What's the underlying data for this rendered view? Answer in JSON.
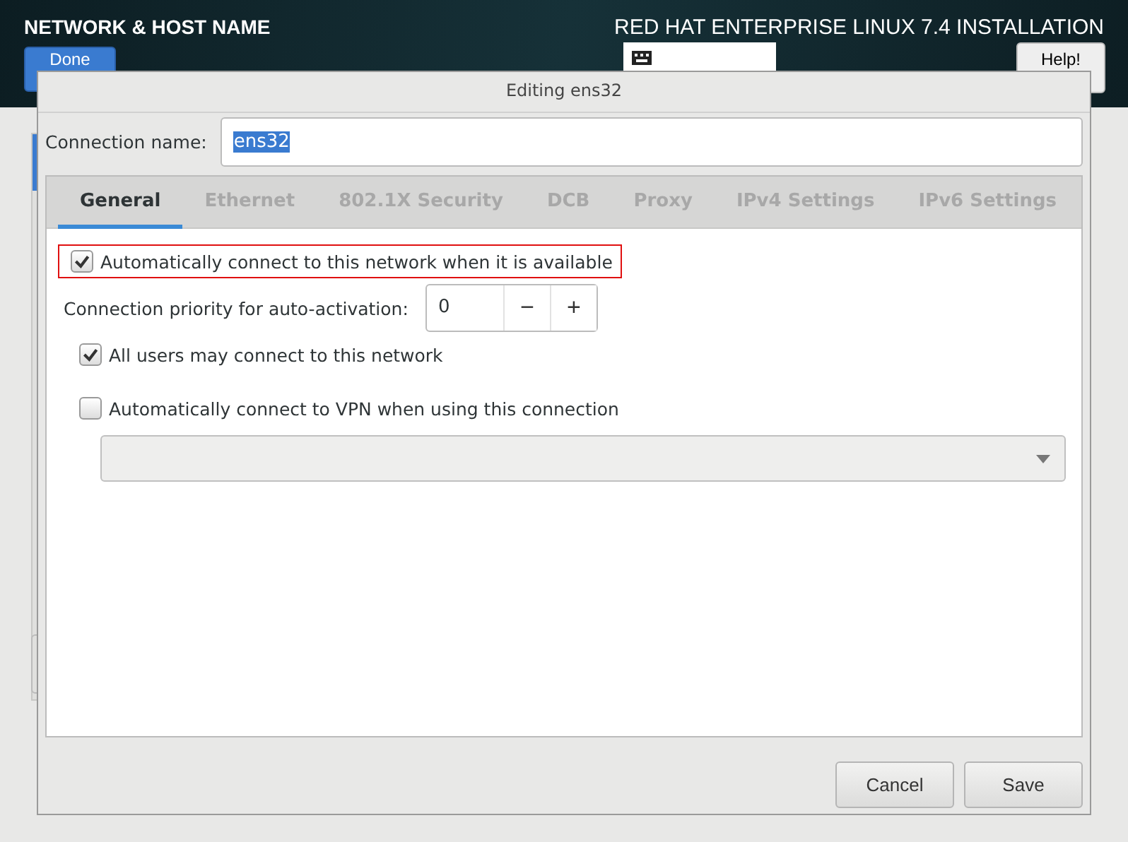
{
  "header": {
    "title": "NETWORK & HOST NAME",
    "product": "RED HAT ENTERPRISE LINUX 7.4 INSTALLATION",
    "done_button": "Done",
    "help_button": "Help!"
  },
  "dialog": {
    "title": "Editing ens32",
    "connection_name": {
      "label": "Connection name:",
      "value": "ens32"
    },
    "tabs": [
      {
        "label": "General",
        "selected": true
      },
      {
        "label": "Ethernet",
        "selected": false
      },
      {
        "label": "802.1X Security",
        "selected": false
      },
      {
        "label": "DCB",
        "selected": false
      },
      {
        "label": "Proxy",
        "selected": false
      },
      {
        "label": "IPv4 Settings",
        "selected": false
      },
      {
        "label": "IPv6 Settings",
        "selected": false
      }
    ],
    "auto_connect": {
      "label": "Automatically connect to this network when it is available",
      "checked": true,
      "highlighted": true
    },
    "priority": {
      "label": "Connection priority for auto-activation:",
      "value": "0",
      "minus": "−",
      "plus": "+"
    },
    "all_users": {
      "label": "All users may connect to this network",
      "checked": true
    },
    "vpn": {
      "label": "Automatically connect to VPN when using this connection",
      "checked": false
    },
    "buttons": [
      "Cancel",
      "Save"
    ]
  }
}
